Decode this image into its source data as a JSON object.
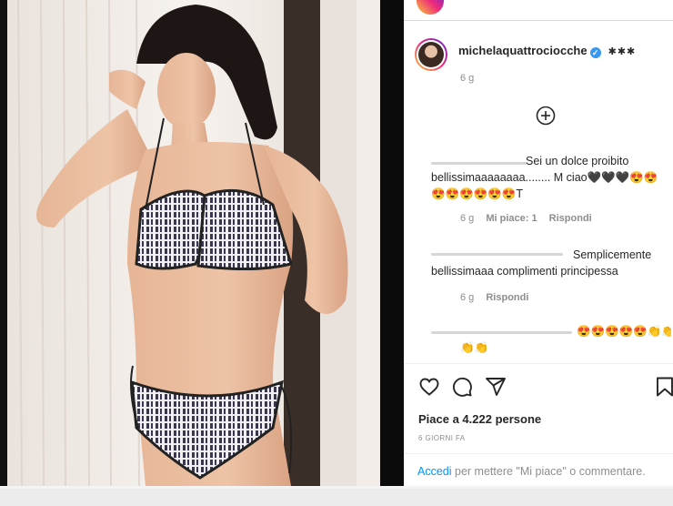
{
  "post": {
    "username": "michelaquattrociocche",
    "caption": "✱✱✱",
    "time": "6 g",
    "icons": {
      "verified": "verified-badge-icon",
      "load_more": "plus-circle-icon"
    }
  },
  "comments": [
    {
      "text": "Sei un dolce proibito bellissimaaaaaaaa........ M ciao🖤🖤🖤😍😍😍😍😍😍😍😍T",
      "time": "6 g",
      "likes": "Mi piace: 1",
      "reply": "Rispondi"
    },
    {
      "text": "Semplicemente bellissimaaa complimenti principessa",
      "time": "6 g",
      "reply": "Rispondi"
    },
    {
      "text": "😍😍😍😍😍👏👏👏👏",
      "text2": "👏👏"
    }
  ],
  "actions": {
    "like": "heart-icon",
    "comment": "comment-icon",
    "share": "share-icon",
    "save": "bookmark-icon"
  },
  "likes_text": "Piace a 4.222 persone",
  "posted_ago": "6 GIORNI FA",
  "login": {
    "link": "Accedi",
    "rest": "per mettere \"Mi piace\" o commentare."
  }
}
